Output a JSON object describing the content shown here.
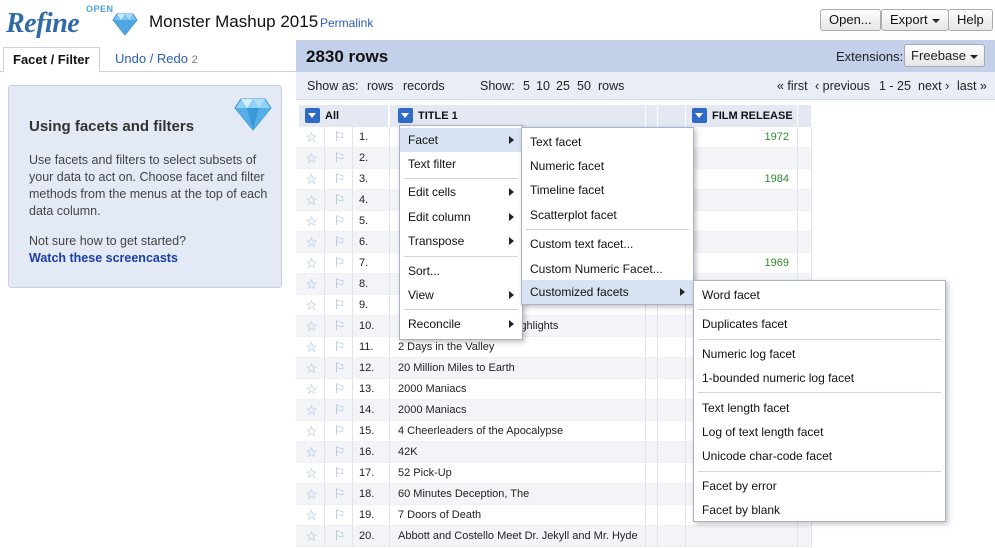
{
  "app": {
    "logo_main": "Refine",
    "logo_sup": "OPEN",
    "project_title": "Monster Mashup 2015",
    "permalink": "Permalink"
  },
  "header_buttons": {
    "open": "Open...",
    "export": "Export",
    "help": "Help"
  },
  "left_panel": {
    "tab_facet": "Facet / Filter",
    "tab_undo": "Undo / Redo",
    "tab_undo_count": "2",
    "help_title": "Using facets and filters",
    "help_body": "Use facets and filters to select subsets of your data to act on. Choose facet and filter methods from the menus at the top of each data column.",
    "help_question": "Not sure how to get started?",
    "help_link": "Watch these screencasts"
  },
  "toolbar": {
    "rows_count": "2830 rows",
    "extensions_label": "Extensions:",
    "extensions_value": "Freebase",
    "show_as_label": "Show as:",
    "show_as_rows": "rows",
    "show_as_records": "records",
    "show_label": "Show:",
    "page_sizes": [
      "5",
      "10",
      "25",
      "50"
    ],
    "page_sizes_suffix": "rows",
    "first": "« first",
    "previous": "‹ previous",
    "range": "1 - 25",
    "next": "next ›",
    "last": "last »"
  },
  "columns": {
    "all": "All",
    "title": "TITLE 1",
    "film_release": "FILM RELEASE"
  },
  "rows": [
    {
      "idx": "1.",
      "title": "",
      "year": "1972"
    },
    {
      "idx": "2.",
      "title": "",
      "year": ""
    },
    {
      "idx": "3.",
      "title": "",
      "year": "1984"
    },
    {
      "idx": "4.",
      "title": "",
      "year": ""
    },
    {
      "idx": "5.",
      "title": "",
      "year": ""
    },
    {
      "idx": "6.",
      "title": "",
      "year": ""
    },
    {
      "idx": "7.",
      "title": "",
      "year": "1969"
    },
    {
      "idx": "8.",
      "title": "",
      "year": ""
    },
    {
      "idx": "9.",
      "title": "",
      "year": ""
    },
    {
      "idx": "10.",
      "title": "",
      "year": ""
    },
    {
      "idx": "11.",
      "title": "2 Days in the Valley",
      "year": ""
    },
    {
      "idx": "12.",
      "title": "20 Million Miles to Earth",
      "year": ""
    },
    {
      "idx": "13.",
      "title": "2000 Maniacs",
      "year": ""
    },
    {
      "idx": "14.",
      "title": "2000 Maniacs",
      "year": ""
    },
    {
      "idx": "15.",
      "title": "4 Cheerleaders of the Apocalypse",
      "year": ""
    },
    {
      "idx": "16.",
      "title": "42K",
      "year": ""
    },
    {
      "idx": "17.",
      "title": "52 Pick-Up",
      "year": ""
    },
    {
      "idx": "18.",
      "title": "60 Minutes Deception, The",
      "year": ""
    },
    {
      "idx": "19.",
      "title": "7 Doors of Death",
      "year": ""
    },
    {
      "idx": "20.",
      "title": "Abbott and Costello Meet Dr. Jekyll and Mr. Hyde",
      "year": ""
    }
  ],
  "partial_titles": {
    "row9_tail": "e",
    "row10_tail": "ighlights"
  },
  "menu_main": {
    "facet": "Facet",
    "text_filter": "Text filter",
    "edit_cells": "Edit cells",
    "edit_column": "Edit column",
    "transpose": "Transpose",
    "sort": "Sort...",
    "view": "View",
    "reconcile": "Reconcile"
  },
  "menu_facet": {
    "text_facet": "Text facet",
    "numeric_facet": "Numeric facet",
    "timeline_facet": "Timeline facet",
    "scatterplot_facet": "Scatterplot facet",
    "custom_text_facet": "Custom text facet...",
    "custom_numeric_facet": "Custom Numeric Facet...",
    "customized_facets": "Customized facets"
  },
  "menu_customized": {
    "word_facet": "Word facet",
    "duplicates_facet": "Duplicates facet",
    "numeric_log_facet": "Numeric log facet",
    "bounded_log_facet": "1-bounded numeric log facet",
    "text_length_facet": "Text length facet",
    "log_text_length_facet": "Log of text length facet",
    "unicode_facet": "Unicode char-code facet",
    "facet_by_error": "Facet by error",
    "facet_by_blank": "Facet by blank"
  },
  "icons": {
    "logo": "diamond-icon",
    "star": "star-icon",
    "flag": "flag-icon"
  },
  "colors": {
    "accent": "#2f6ac7",
    "link": "#2c5fb5",
    "year": "#2f8a2f",
    "header_bar": "#c3d0ea"
  }
}
